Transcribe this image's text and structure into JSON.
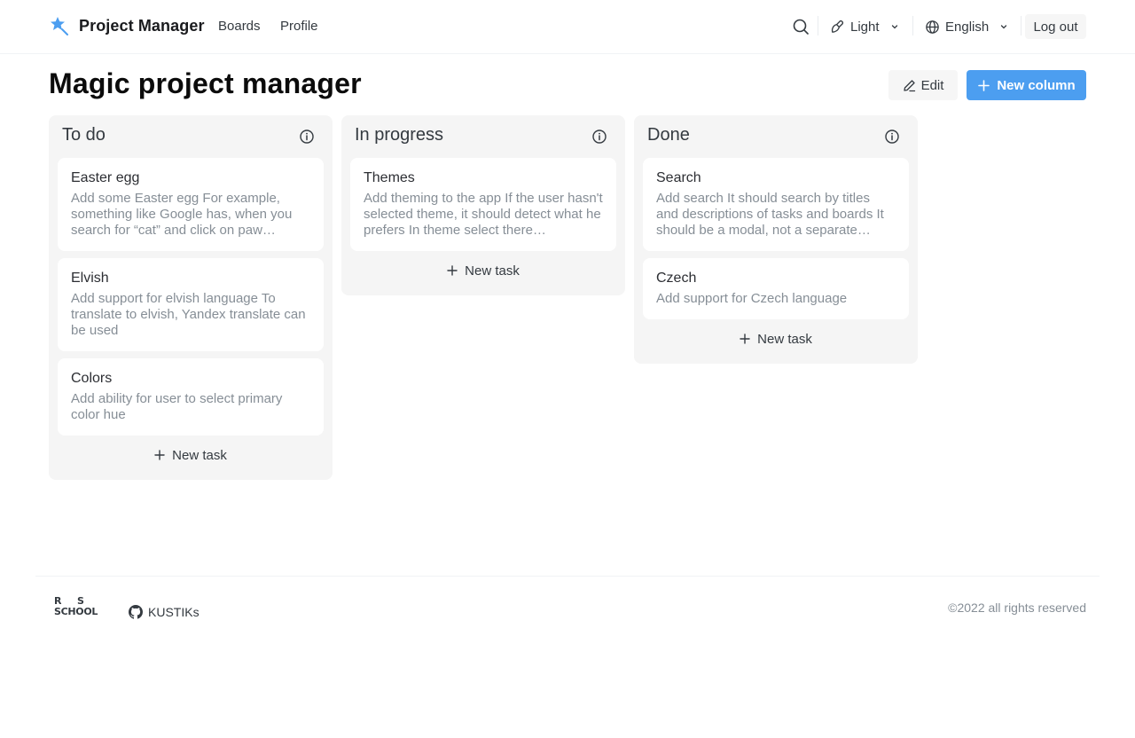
{
  "header": {
    "app_title": "Project Manager",
    "logo_icon": "magic-wand-star-icon",
    "nav": [
      {
        "label": "Boards"
      },
      {
        "label": "Profile"
      }
    ],
    "search_icon": "search-icon",
    "theme": {
      "label": "Light",
      "icon": "brush-icon"
    },
    "language": {
      "label": "English",
      "icon": "globe-icon"
    },
    "logout_label": "Log out"
  },
  "board": {
    "title": "Magic project manager",
    "edit_label": "Edit",
    "new_column_label": "New column",
    "accent_color": "#4c9ef0"
  },
  "columns": [
    {
      "title": "To do",
      "tasks": [
        {
          "title": "Easter egg",
          "description": "Add some Easter egg For example, something like Google has, when you search for “cat” and click on paw…"
        },
        {
          "title": "Elvish",
          "description": "Add support for elvish language To translate to elvish, Yandex translate can be used"
        },
        {
          "title": "Colors",
          "description": "Add ability for user to select primary color hue"
        }
      ],
      "new_task_label": "New task"
    },
    {
      "title": "In progress",
      "tasks": [
        {
          "title": "Themes",
          "description": "Add theming to the app If the user hasn't selected theme, it should detect what he prefers In theme select there…"
        }
      ],
      "new_task_label": "New task"
    },
    {
      "title": "Done",
      "tasks": [
        {
          "title": "Search",
          "description": "Add search It should search by titles and descriptions of tasks and boards It should be a modal, not a separate…"
        },
        {
          "title": "Czech",
          "description": "Add support for Czech language"
        }
      ],
      "new_task_label": "New task"
    }
  ],
  "footer": {
    "school_logo": {
      "r": "R",
      "s": "S",
      "school": "SCHOOL"
    },
    "github_label": "KUSTIKs",
    "copyright": "©2022 all rights reserved"
  }
}
